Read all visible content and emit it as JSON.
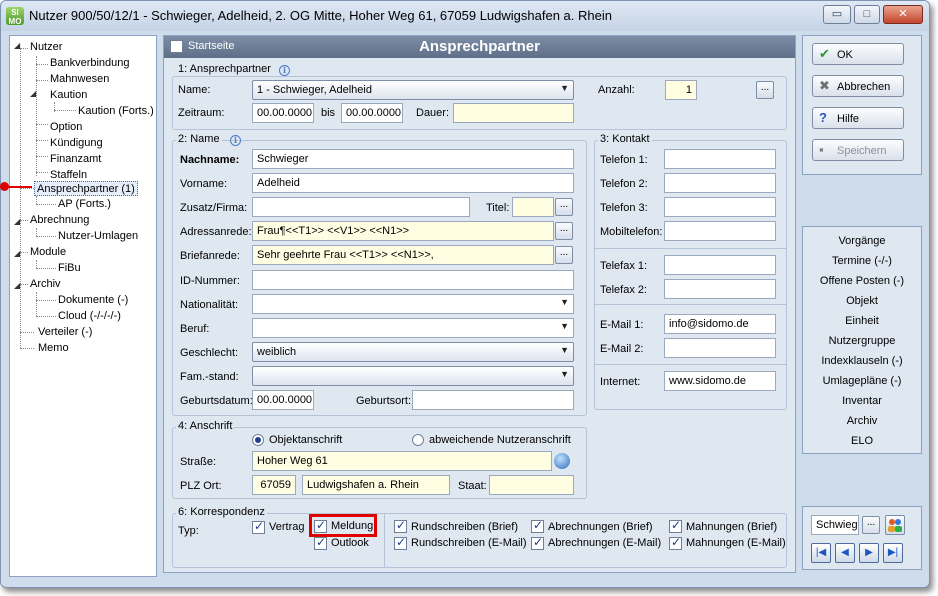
{
  "window": {
    "title": "Nutzer 900/50/12/1 - Schwieger, Adelheid, 2. OG Mitte, Hoher Weg 61, 67059 Ludwigshafen a. Rhein",
    "app_icon_text": "SI MO",
    "minimize": "▭",
    "maximize": "□",
    "close": "✕"
  },
  "tree": {
    "items": [
      {
        "label": "Nutzer"
      },
      {
        "label": "Bankverbindung"
      },
      {
        "label": "Mahnwesen"
      },
      {
        "label": "Kaution"
      },
      {
        "label": "Kaution (Forts.)"
      },
      {
        "label": "Option"
      },
      {
        "label": "Kündigung"
      },
      {
        "label": "Finanzamt"
      },
      {
        "label": "Staffeln"
      },
      {
        "label": "Ansprechpartner (1)"
      },
      {
        "label": "AP (Forts.)"
      },
      {
        "label": "Abrechnung"
      },
      {
        "label": "Nutzer-Umlagen"
      },
      {
        "label": "Module"
      },
      {
        "label": "FiBu"
      },
      {
        "label": "Archiv"
      },
      {
        "label": "Dokumente (-)"
      },
      {
        "label": "Cloud (-/-/-/-)"
      },
      {
        "label": "Verteiler (-)"
      },
      {
        "label": "Memo"
      }
    ]
  },
  "header": {
    "startseite": "Startseite",
    "title": "Ansprechpartner"
  },
  "g1": {
    "title": "1: Ansprechpartner",
    "name_label": "Name:",
    "name_value": "1 - Schwieger, Adelheid",
    "zeitraum_label": "Zeitraum:",
    "zeitraum_from": "00.00.0000",
    "bis_label": "bis",
    "zeitraum_to": "00.00.0000",
    "dauer_label": "Dauer:",
    "dauer_value": "",
    "anzahl_label": "Anzahl:",
    "anzahl_value": "1",
    "ellipsis": "..."
  },
  "g2": {
    "title": "2: Name",
    "nachname_label": "Nachname:",
    "nachname_value": "Schwieger",
    "vorname_label": "Vorname:",
    "vorname_value": "Adelheid",
    "zusatz_label": "Zusatz/Firma:",
    "zusatz_value": "",
    "titel_label": "Titel:",
    "titel_value": "",
    "adressanrede_label": "Adressanrede:",
    "adressanrede_value": "Frau¶<<T1>> <<V1>> <<N1>>",
    "briefanrede_label": "Briefanrede:",
    "briefanrede_value": "Sehr geehrte Frau <<T1>> <<N1>>,",
    "idnummer_label": "ID-Nummer:",
    "idnummer_value": "",
    "nationalitaet_label": "Nationalität:",
    "nationalitaet_value": "",
    "beruf_label": "Beruf:",
    "beruf_value": "",
    "geschlecht_label": "Geschlecht:",
    "geschlecht_value": "weiblich",
    "famstand_label": "Fam.-stand:",
    "famstand_value": "",
    "geburtsdatum_label": "Geburtsdatum:",
    "geburtsdatum_value": "00.00.0000",
    "geburtsort_label": "Geburtsort:",
    "geburtsort_value": ""
  },
  "g3": {
    "title": "3: Kontakt",
    "telefon1_label": "Telefon 1:",
    "telefon1_value": "",
    "telefon2_label": "Telefon 2:",
    "telefon2_value": "",
    "telefon3_label": "Telefon 3:",
    "telefon3_value": "",
    "mobil_label": "Mobiltelefon:",
    "mobil_value": "",
    "fax1_label": "Telefax 1:",
    "fax1_value": "",
    "fax2_label": "Telefax 2:",
    "fax2_value": "",
    "email1_label": "E-Mail 1:",
    "email1_value": "info@sidomo.de",
    "email2_label": "E-Mail 2:",
    "email2_value": "",
    "internet_label": "Internet:",
    "internet_value": "www.sidomo.de"
  },
  "g4": {
    "title": "4: Anschrift",
    "radio1": "Objektanschrift",
    "radio2": "abweichende Nutzeranschrift",
    "strasse_label": "Straße:",
    "strasse_value": "Hoher Weg 61",
    "plz_label": "PLZ Ort:",
    "plz_value": "67059",
    "ort_value": "Ludwigshafen a. Rhein",
    "staat_label": "Staat:",
    "staat_value": ""
  },
  "g6": {
    "title": "6: Korrespondenz",
    "typ_label": "Typ:",
    "vertrag": "Vertrag",
    "meldung": "Meldung",
    "outlook": "Outlook",
    "rund_brief": "Rundschreiben (Brief)",
    "rund_email": "Rundschreiben (E-Mail)",
    "abr_brief": "Abrechnungen (Brief)",
    "abr_email": "Abrechnungen (E-Mail)",
    "mahn_brief": "Mahnungen (Brief)",
    "mahn_email": "Mahnungen (E-Mail)"
  },
  "buttons": {
    "ok": "OK",
    "abbrechen": "Abbrechen",
    "hilfe": "Hilfe",
    "speichern": "Speichern"
  },
  "links": {
    "items": [
      {
        "label": "Vorgänge"
      },
      {
        "label": "Termine (-/-)"
      },
      {
        "label": "Offene Posten (-)"
      },
      {
        "label": "Objekt"
      },
      {
        "label": "Einheit"
      },
      {
        "label": "Nutzergruppe"
      },
      {
        "label": "Indexklauseln (-)"
      },
      {
        "label": "Umlagepläne (-)"
      },
      {
        "label": "Inventar"
      },
      {
        "label": "Archiv"
      },
      {
        "label": "ELO"
      }
    ]
  },
  "search": {
    "value": "Schwieg",
    "ellipsis": "..."
  },
  "nav": {
    "first": "|◀",
    "prev": "◀",
    "next": "▶",
    "last": "▶|"
  }
}
